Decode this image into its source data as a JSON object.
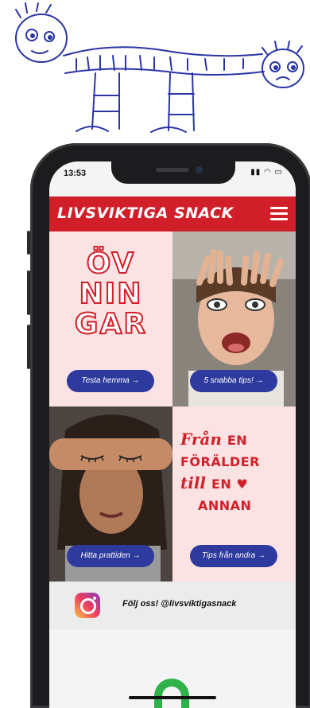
{
  "status_bar": {
    "time": "13:53",
    "icons": "▮▮ ◠ ▭"
  },
  "header": {
    "brand": "LIVSVIKTIGA SNACK",
    "menu_icon": "hamburger-icon"
  },
  "tiles": [
    {
      "id": "ovningar",
      "heading_lines": [
        "ÖV",
        "NIN",
        "GAR"
      ],
      "button_label": "Testa hemma →"
    },
    {
      "id": "tips",
      "button_label": "5 snabba tips! →"
    },
    {
      "id": "prattiden",
      "button_label": "Hitta prattiden →"
    },
    {
      "id": "fran-en-foralder",
      "heading": {
        "line1": "Från",
        "line1b": "EN",
        "line2": "FÖRÄLDER",
        "line3": "till",
        "line3b": "EN ♥",
        "line4": "ANNAN"
      },
      "button_label": "Tips från andra →"
    }
  ],
  "instagram": {
    "text": "Följ oss! @livsviktigasnack",
    "icon": "instagram-icon"
  },
  "colors": {
    "brand_red": "#d11f2a",
    "button_blue": "#2e3a9e",
    "tile_pink": "#fbe3e3",
    "phone_frame": "#1c1c1e"
  }
}
